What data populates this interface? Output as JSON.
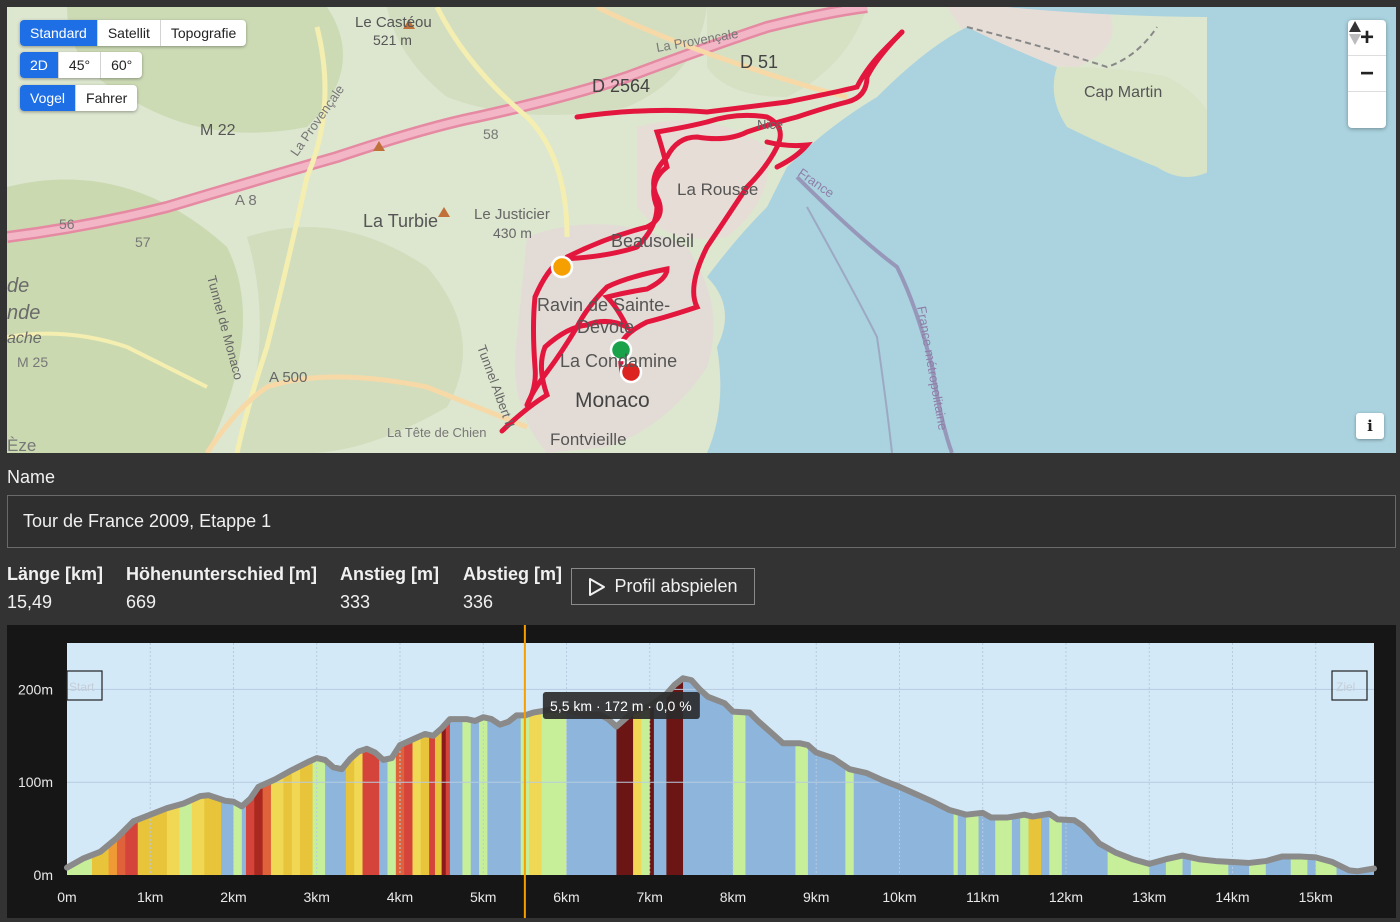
{
  "map": {
    "layer_tabs": [
      "Standard",
      "Satellit",
      "Topografie"
    ],
    "view_tabs": [
      "2D",
      "45°",
      "60°"
    ],
    "perspective_tabs": [
      "Vogel",
      "Fahrer"
    ],
    "zoom_in": "+",
    "zoom_out": "−",
    "reset_north": "▲",
    "info": "i",
    "labels": [
      "Le Castéou",
      "521 m",
      "La Provençale",
      "D 2564",
      "D 51",
      "58",
      "M 22",
      "La Provençale",
      "A 8",
      "56",
      "57",
      "La Turbie",
      "Le Justicier",
      "430 m",
      "La Rousse",
      "Beausoleil",
      "Ravin de Sainte-",
      "Dévote",
      "La Condamine",
      "Monaco",
      "Fontvieille",
      "Cap Martin",
      "France",
      "France métropolitaine",
      "A 500",
      "M 25",
      "Tunnel de Monaco",
      "Tunnel Albert II",
      "La Tête de Chien",
      "de",
      "nde",
      "ache",
      "Èze",
      "Nice"
    ],
    "colors": {
      "route": "#e3173e",
      "sea": "#aad3df",
      "marker_orange": "#f5a000",
      "marker_green": "#1aa24b",
      "marker_red": "#dd2222"
    }
  },
  "form": {
    "name_label": "Name",
    "name_value": "Tour de France 2009, Etappe 1"
  },
  "stats": {
    "length_label": "Länge [km]",
    "length_value": "15,49",
    "height_diff_label": "Höhenunterschied [m]",
    "height_diff_value": "669",
    "ascent_label": "Anstieg [m]",
    "ascent_value": "333",
    "descent_label": "Abstieg [m]",
    "descent_value": "336"
  },
  "play_button": {
    "label": "Profil abspielen"
  },
  "chart_data": {
    "type": "area",
    "x_unit": "km",
    "xlim": [
      0,
      15.7
    ],
    "ylim": [
      0,
      250
    ],
    "x_ticks": [
      0,
      1,
      2,
      3,
      4,
      5,
      6,
      7,
      8,
      9,
      10,
      11,
      12,
      13,
      14,
      15
    ],
    "x_tick_labels": [
      "0m",
      "1km",
      "2km",
      "3km",
      "4km",
      "5km",
      "6km",
      "7km",
      "8km",
      "9km",
      "10km",
      "11km",
      "12km",
      "13km",
      "14km",
      "15km"
    ],
    "y_ticks": [
      0,
      100,
      200
    ],
    "y_tick_labels": [
      "0m",
      "100m",
      "200m"
    ],
    "profile": [
      [
        0,
        8
      ],
      [
        0.2,
        18
      ],
      [
        0.4,
        25
      ],
      [
        0.6,
        40
      ],
      [
        0.8,
        58
      ],
      [
        1.0,
        65
      ],
      [
        1.2,
        72
      ],
      [
        1.4,
        77
      ],
      [
        1.6,
        85
      ],
      [
        1.7,
        86
      ],
      [
        1.9,
        80
      ],
      [
        2.0,
        79
      ],
      [
        2.1,
        74
      ],
      [
        2.2,
        82
      ],
      [
        2.3,
        95
      ],
      [
        2.5,
        103
      ],
      [
        2.7,
        113
      ],
      [
        2.9,
        122
      ],
      [
        3.0,
        126
      ],
      [
        3.1,
        124
      ],
      [
        3.2,
        116
      ],
      [
        3.3,
        114
      ],
      [
        3.4,
        125
      ],
      [
        3.5,
        133
      ],
      [
        3.6,
        136
      ],
      [
        3.7,
        132
      ],
      [
        3.8,
        124
      ],
      [
        3.9,
        126
      ],
      [
        4.0,
        140
      ],
      [
        4.2,
        148
      ],
      [
        4.3,
        152
      ],
      [
        4.4,
        150
      ],
      [
        4.5,
        158
      ],
      [
        4.6,
        168
      ],
      [
        4.8,
        168
      ],
      [
        4.9,
        166
      ],
      [
        5.0,
        170
      ],
      [
        5.1,
        168
      ],
      [
        5.2,
        162
      ],
      [
        5.3,
        165
      ],
      [
        5.4,
        172
      ],
      [
        5.5,
        172
      ],
      [
        5.6,
        175
      ],
      [
        5.8,
        178
      ],
      [
        6.0,
        178
      ],
      [
        6.2,
        173
      ],
      [
        6.4,
        173
      ],
      [
        6.5,
        168
      ],
      [
        6.6,
        160
      ],
      [
        6.7,
        168
      ],
      [
        6.8,
        176
      ],
      [
        7.0,
        182
      ],
      [
        7.2,
        195
      ],
      [
        7.3,
        205
      ],
      [
        7.4,
        212
      ],
      [
        7.5,
        210
      ],
      [
        7.6,
        200
      ],
      [
        7.7,
        192
      ],
      [
        7.9,
        185
      ],
      [
        8.0,
        176
      ],
      [
        8.2,
        175
      ],
      [
        8.3,
        166
      ],
      [
        8.4,
        158
      ],
      [
        8.5,
        150
      ],
      [
        8.6,
        142
      ],
      [
        8.8,
        142
      ],
      [
        8.9,
        140
      ],
      [
        9.0,
        132
      ],
      [
        9.2,
        126
      ],
      [
        9.4,
        114
      ],
      [
        9.6,
        110
      ],
      [
        9.8,
        102
      ],
      [
        10.0,
        95
      ],
      [
        10.2,
        87
      ],
      [
        10.4,
        79
      ],
      [
        10.6,
        70
      ],
      [
        10.8,
        65
      ],
      [
        11.0,
        67
      ],
      [
        11.1,
        62
      ],
      [
        11.3,
        62
      ],
      [
        11.5,
        65
      ],
      [
        11.6,
        63
      ],
      [
        11.8,
        66
      ],
      [
        11.9,
        60
      ],
      [
        12.1,
        59
      ],
      [
        12.2,
        53
      ],
      [
        12.3,
        44
      ],
      [
        12.4,
        34
      ],
      [
        12.6,
        24
      ],
      [
        12.8,
        17
      ],
      [
        13.0,
        12
      ],
      [
        13.2,
        17
      ],
      [
        13.4,
        21
      ],
      [
        13.6,
        17
      ],
      [
        13.8,
        15
      ],
      [
        14.0,
        14
      ],
      [
        14.2,
        13
      ],
      [
        14.4,
        15
      ],
      [
        14.6,
        20
      ],
      [
        14.8,
        20
      ],
      [
        15.0,
        19
      ],
      [
        15.2,
        14
      ],
      [
        15.4,
        5
      ],
      [
        15.5,
        4
      ],
      [
        15.7,
        7
      ]
    ],
    "bands": [
      [
        0,
        0.3,
        "#c7ef9a"
      ],
      [
        0.3,
        0.5,
        "#e8c43a"
      ],
      [
        0.5,
        0.6,
        "#ef9a35"
      ],
      [
        0.6,
        0.7,
        "#e0623a"
      ],
      [
        0.7,
        0.85,
        "#d4443a"
      ],
      [
        0.85,
        1.2,
        "#e8c43a"
      ],
      [
        1.2,
        1.35,
        "#f0d754"
      ],
      [
        1.35,
        1.5,
        "#c7ef9a"
      ],
      [
        1.5,
        1.65,
        "#f0d754"
      ],
      [
        1.65,
        1.85,
        "#e8c43a"
      ],
      [
        1.85,
        2.0,
        "#8eb6dc"
      ],
      [
        2.0,
        2.1,
        "#c7ef9a"
      ],
      [
        2.1,
        2.15,
        "#8eb6dc"
      ],
      [
        2.15,
        2.25,
        "#d4443a"
      ],
      [
        2.25,
        2.35,
        "#a9281f"
      ],
      [
        2.35,
        2.45,
        "#e0623a"
      ],
      [
        2.45,
        2.6,
        "#f0d754"
      ],
      [
        2.6,
        2.7,
        "#e8c43a"
      ],
      [
        2.7,
        2.8,
        "#f0d754"
      ],
      [
        2.8,
        2.95,
        "#e8c43a"
      ],
      [
        2.95,
        3.1,
        "#c7ef9a"
      ],
      [
        3.1,
        3.35,
        "#8eb6dc"
      ],
      [
        3.35,
        3.45,
        "#e8c43a"
      ],
      [
        3.45,
        3.55,
        "#f0d754"
      ],
      [
        3.55,
        3.75,
        "#d4443a"
      ],
      [
        3.75,
        3.85,
        "#8eb6dc"
      ],
      [
        3.85,
        3.95,
        "#c7ef9a"
      ],
      [
        3.95,
        4.05,
        "#e0623a"
      ],
      [
        4.05,
        4.15,
        "#d4443a"
      ],
      [
        4.15,
        4.25,
        "#f0d754"
      ],
      [
        4.25,
        4.35,
        "#e8c43a"
      ],
      [
        4.35,
        4.42,
        "#d4443a"
      ],
      [
        4.42,
        4.5,
        "#e8c43a"
      ],
      [
        4.5,
        4.55,
        "#8b1a1a"
      ],
      [
        4.55,
        4.6,
        "#d4443a"
      ],
      [
        4.6,
        4.75,
        "#8eb6dc"
      ],
      [
        4.75,
        4.85,
        "#c7ef9a"
      ],
      [
        4.85,
        4.95,
        "#8eb6dc"
      ],
      [
        4.95,
        5.05,
        "#c7ef9a"
      ],
      [
        5.05,
        5.45,
        "#8eb6dc"
      ],
      [
        5.45,
        5.55,
        "#c7ef9a"
      ],
      [
        5.55,
        5.7,
        "#f0d754"
      ],
      [
        5.7,
        6.0,
        "#c7ef9a"
      ],
      [
        6.0,
        6.6,
        "#8eb6dc"
      ],
      [
        6.6,
        6.8,
        "#6b1515"
      ],
      [
        6.8,
        6.9,
        "#f0d754"
      ],
      [
        6.9,
        7.0,
        "#c7ef9a"
      ],
      [
        7.0,
        7.05,
        "#6b1515"
      ],
      [
        7.05,
        7.2,
        "#8eb6dc"
      ],
      [
        7.2,
        7.4,
        "#6b1515"
      ],
      [
        7.4,
        8.0,
        "#8eb6dc"
      ],
      [
        8.0,
        8.15,
        "#c7ef9a"
      ],
      [
        8.15,
        8.75,
        "#8eb6dc"
      ],
      [
        8.75,
        8.9,
        "#c7ef9a"
      ],
      [
        8.9,
        9.35,
        "#8eb6dc"
      ],
      [
        9.35,
        9.45,
        "#c7ef9a"
      ],
      [
        9.45,
        10.65,
        "#8eb6dc"
      ],
      [
        10.65,
        10.7,
        "#c7ef9a"
      ],
      [
        10.7,
        10.8,
        "#8eb6dc"
      ],
      [
        10.8,
        10.95,
        "#c7ef9a"
      ],
      [
        10.95,
        11.15,
        "#8eb6dc"
      ],
      [
        11.15,
        11.35,
        "#c7ef9a"
      ],
      [
        11.35,
        11.45,
        "#8eb6dc"
      ],
      [
        11.45,
        11.55,
        "#c7ef9a"
      ],
      [
        11.55,
        11.7,
        "#e8c43a"
      ],
      [
        11.7,
        11.8,
        "#8eb6dc"
      ],
      [
        11.8,
        11.95,
        "#c7ef9a"
      ],
      [
        11.95,
        12.5,
        "#8eb6dc"
      ],
      [
        12.5,
        13.0,
        "#c7ef9a"
      ],
      [
        13.0,
        13.2,
        "#8eb6dc"
      ],
      [
        13.2,
        13.4,
        "#c7ef9a"
      ],
      [
        13.4,
        13.5,
        "#8eb6dc"
      ],
      [
        13.5,
        13.95,
        "#c7ef9a"
      ],
      [
        13.95,
        14.2,
        "#8eb6dc"
      ],
      [
        14.2,
        14.4,
        "#c7ef9a"
      ],
      [
        14.4,
        14.7,
        "#8eb6dc"
      ],
      [
        14.7,
        14.9,
        "#c7ef9a"
      ],
      [
        14.9,
        15.0,
        "#8eb6dc"
      ],
      [
        15.0,
        15.25,
        "#c7ef9a"
      ],
      [
        15.25,
        15.7,
        "#8eb6dc"
      ]
    ],
    "cursor": {
      "x": 5.5,
      "label": "5,5 km · 172 m · 0,0 %"
    },
    "start_label": "Start",
    "end_label": "Ziel",
    "colors": {
      "plot_bg": "#d4e9f8",
      "outline": "#8a8a8a",
      "cursor": "#f5a000",
      "grid": "#b7cbe0"
    }
  }
}
